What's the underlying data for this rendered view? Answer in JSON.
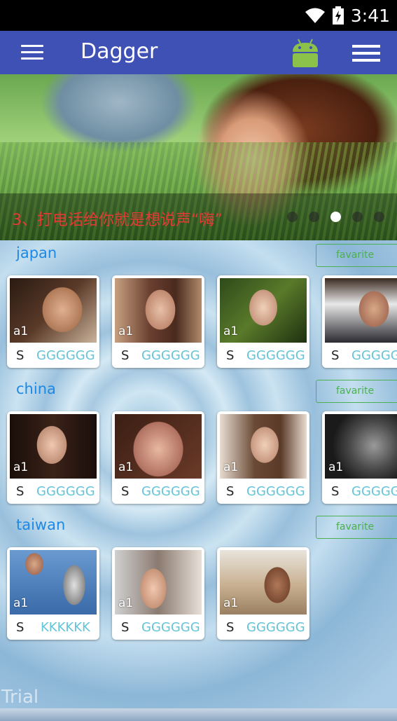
{
  "status_bar": {
    "time": "3:41",
    "icons": [
      "wifi-icon",
      "battery-charging-icon"
    ]
  },
  "app_bar": {
    "title": "Dagger",
    "icons": [
      "hamburger-menu-icon",
      "android-icon",
      "list-view-icon"
    ]
  },
  "banner": {
    "caption": "3、打电话给你就是想说声“嗨”",
    "page_count": 5,
    "active_page": 3
  },
  "sections": [
    {
      "title": "japan",
      "button": "favarite",
      "items": [
        {
          "label": "a1",
          "s": "S",
          "value": "GGGGGG"
        },
        {
          "label": "a1",
          "s": "S",
          "value": "GGGGGG"
        },
        {
          "label": "a1",
          "s": "S",
          "value": "GGGGGG"
        },
        {
          "label": "",
          "s": "S",
          "value": "GGGGGG"
        }
      ]
    },
    {
      "title": "china",
      "button": "favarite",
      "items": [
        {
          "label": "a1",
          "s": "S",
          "value": "GGGGGG"
        },
        {
          "label": "a1",
          "s": "S",
          "value": "GGGGGG"
        },
        {
          "label": "a1",
          "s": "S",
          "value": "GGGGGG"
        },
        {
          "label": "a1",
          "s": "S",
          "value": "GGGGGG"
        }
      ]
    },
    {
      "title": "taiwan",
      "button": "favarite",
      "items": [
        {
          "label": "a1",
          "s": "S",
          "value": "KKKKKK"
        },
        {
          "label": "a1",
          "s": "S",
          "value": "GGGGGG"
        },
        {
          "label": "a1",
          "s": "S",
          "value": "GGGGGG"
        }
      ]
    }
  ],
  "watermark": "Trial",
  "colors": {
    "app_bar": "#3f51b5",
    "caption": "#e53935",
    "heading": "#1e88e5",
    "favorite_button": "#4caf50",
    "card_value": "#64c4d8"
  }
}
